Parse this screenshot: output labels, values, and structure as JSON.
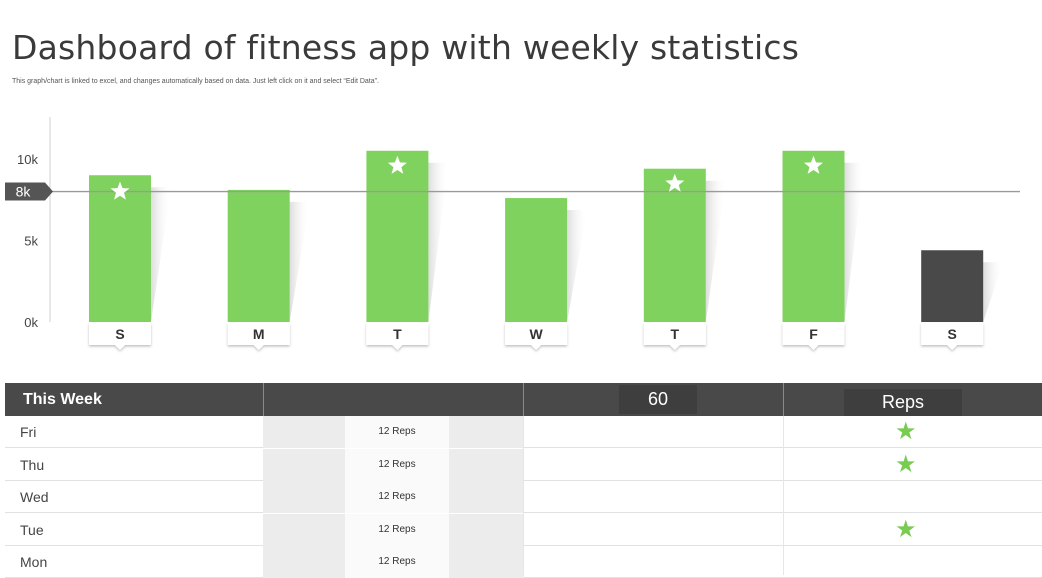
{
  "page": {
    "title": "Dashboard of fitness app with weekly statistics",
    "subtitle": "This graph/chart is linked to excel, and changes automatically based on data. Just left click on it and select “Edit Data”."
  },
  "colors": {
    "bar": "#7fd25e",
    "bar_dark": "#4a494a",
    "star": "#ffffff",
    "target_line": "#9a9a9a",
    "marker": "#555555"
  },
  "chart_data": {
    "type": "bar",
    "categories": [
      "S",
      "M",
      "T",
      "W",
      "T",
      "F",
      "S"
    ],
    "values": [
      9000,
      8100,
      10500,
      7600,
      9400,
      10500,
      4400
    ],
    "starred": [
      true,
      false,
      true,
      false,
      true,
      true,
      false
    ],
    "highlight_dark": [
      false,
      false,
      false,
      false,
      false,
      false,
      true
    ],
    "ytick_labels": [
      "0k",
      "5k",
      "10k"
    ],
    "ytick_values": [
      0,
      5000,
      10000
    ],
    "ylim": [
      0,
      13000
    ],
    "target": {
      "value": 8000,
      "label": "8k"
    },
    "title": "",
    "xlabel": "",
    "ylabel": "",
    "grid": false
  },
  "table": {
    "header": {
      "week_label": "This Week",
      "count": "60",
      "unit": "Reps"
    },
    "rows": [
      {
        "day": "Fri",
        "reps": "12 Reps",
        "star": true
      },
      {
        "day": "Thu",
        "reps": "12 Reps",
        "star": true
      },
      {
        "day": "Wed",
        "reps": "12 Reps",
        "star": false
      },
      {
        "day": "Tue",
        "reps": "12 Reps",
        "star": true
      },
      {
        "day": "Mon",
        "reps": "12 Reps",
        "star": false
      }
    ],
    "star_icon": "star-icon"
  }
}
